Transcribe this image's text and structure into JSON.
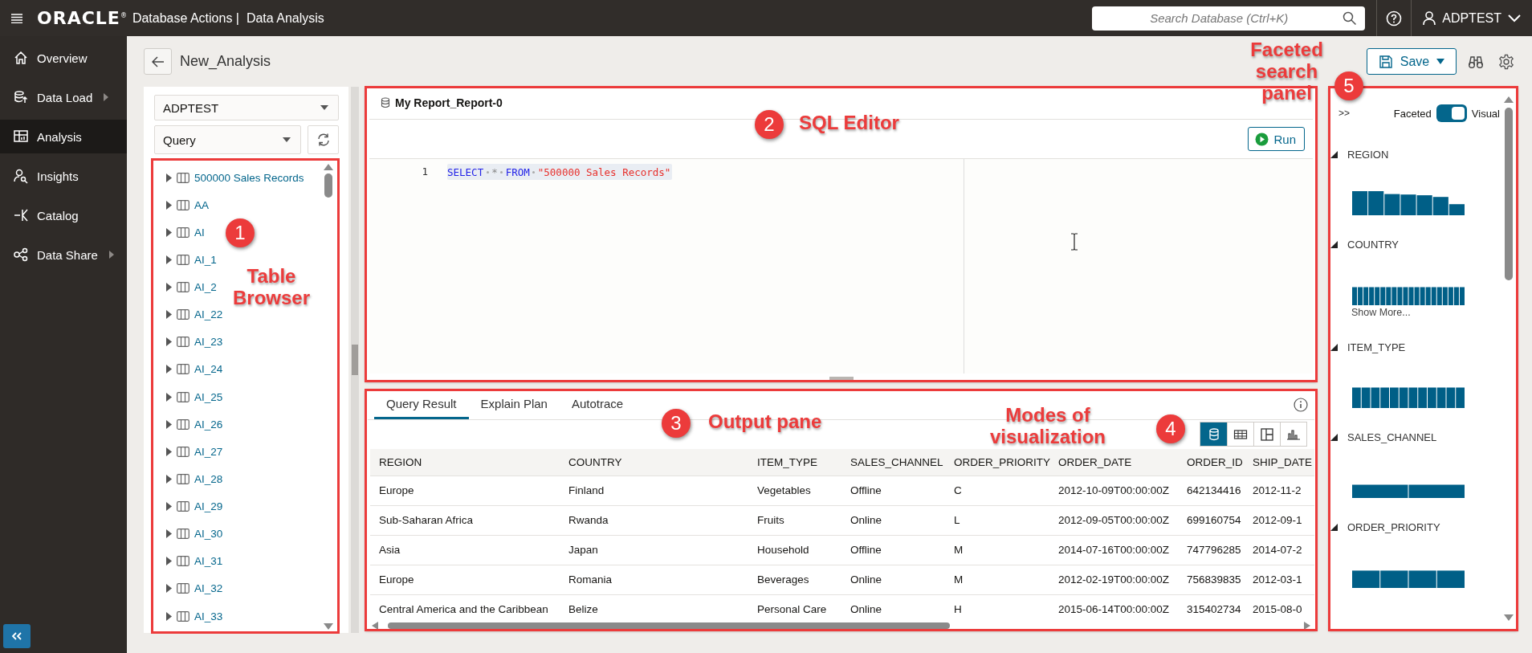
{
  "top_bar": {
    "logo": "ORACLE$^{®}$",
    "title": "Database Actions |  Data Analysis",
    "search": {
      "placeholder": "Search Database (Ctrl+K)"
    },
    "user": "ADPTEST"
  },
  "sidebar": {
    "items": [
      {
        "label": "Overview",
        "selected": false,
        "has_submenu": false
      },
      {
        "label": "Data Load",
        "selected": false,
        "has_submenu": true
      },
      {
        "label": "Analysis",
        "selected": true,
        "has_submenu": false
      },
      {
        "label": "Insights",
        "selected": false,
        "has_submenu": false
      },
      {
        "label": "Catalog",
        "selected": false,
        "has_submenu": false
      },
      {
        "label": "Data Share",
        "selected": false,
        "has_submenu": true
      }
    ]
  },
  "header": {
    "title": "New_Analysis",
    "save": "Save"
  },
  "browser": {
    "schema": "ADPTEST",
    "object_type": "Query",
    "items": [
      {
        "label": "500000 Sales Records",
        "expanded": false
      },
      {
        "label": "AA",
        "expanded": false
      },
      {
        "label": "AI",
        "expanded": false
      },
      {
        "label": "AI_1",
        "expanded": false
      },
      {
        "label": "AI_2",
        "expanded": false
      },
      {
        "label": "AI_22",
        "expanded": false
      },
      {
        "label": "AI_23",
        "expanded": false
      },
      {
        "label": "AI_24",
        "expanded": false
      },
      {
        "label": "AI_25",
        "expanded": false
      },
      {
        "label": "AI_26",
        "expanded": false
      },
      {
        "label": "AI_27",
        "expanded": false
      },
      {
        "label": "AI_28",
        "expanded": false
      },
      {
        "label": "AI_29",
        "expanded": false
      },
      {
        "label": "AI_30",
        "expanded": false
      },
      {
        "label": "AI_31",
        "expanded": false
      },
      {
        "label": "AI_32",
        "expanded": false
      },
      {
        "label": "AI_33",
        "expanded": false
      }
    ]
  },
  "editor": {
    "title": "My Report_Report-0",
    "run": "Run",
    "line_number": "1",
    "tokens": [
      {
        "kind": "keyword",
        "text": "SELECT"
      },
      {
        "kind": "operator",
        "text": "*"
      },
      {
        "kind": "keyword",
        "text": "FROM"
      },
      {
        "kind": "string",
        "text": "\"500000 Sales Records\""
      }
    ]
  },
  "output": {
    "tabs": [
      {
        "label": "Query Result",
        "selected": true
      },
      {
        "label": "Explain Plan",
        "selected": false
      },
      {
        "label": "Autotrace",
        "selected": false
      }
    ],
    "view_modes": [
      {
        "selected": true
      },
      {
        "selected": false
      },
      {
        "selected": false
      },
      {
        "selected": false
      }
    ],
    "columns": [
      "REGION",
      "COUNTRY",
      "ITEM_TYPE",
      "SALES_CHANNEL",
      "ORDER_PRIORITY",
      "ORDER_DATE",
      "ORDER_ID",
      "SHIP_DATE"
    ],
    "rows": [
      [
        "Europe",
        "Finland",
        "Vegetables",
        "Offline",
        "C",
        "2012-10-09T00:00:00Z",
        "642134416",
        "2012-11-2"
      ],
      [
        "Sub-Saharan Africa",
        "Rwanda",
        "Fruits",
        "Online",
        "L",
        "2012-09-05T00:00:00Z",
        "699160754",
        "2012-09-1"
      ],
      [
        "Asia",
        "Japan",
        "Household",
        "Offline",
        "M",
        "2014-07-16T00:00:00Z",
        "747796285",
        "2014-07-2"
      ],
      [
        "Europe",
        "Romania",
        "Beverages",
        "Online",
        "M",
        "2012-02-19T00:00:00Z",
        "756839835",
        "2012-03-1"
      ],
      [
        "Central America and the Caribbean",
        "Belize",
        "Personal Care",
        "Online",
        "H",
        "2015-06-14T00:00:00Z",
        "315402734",
        "2015-08-0"
      ]
    ]
  },
  "facets": {
    "collapse": ">>",
    "toggle": {
      "left": "Faceted",
      "right": "Visual",
      "on": true
    },
    "items": [
      {
        "name": "REGION"
      },
      {
        "name": "COUNTRY",
        "show_more": "Show More..."
      },
      {
        "name": "ITEM_TYPE"
      },
      {
        "name": "SALES_CHANNEL"
      },
      {
        "name": "ORDER_PRIORITY"
      }
    ]
  },
  "annotations": [
    {
      "number": "1",
      "label": "Table Browser"
    },
    {
      "number": "2",
      "label": "SQL Editor"
    },
    {
      "number": "3",
      "label": "Output pane"
    },
    {
      "number": "4",
      "label": "Modes of visualization"
    },
    {
      "number": "5",
      "label": "Faceted search panel"
    }
  ]
}
